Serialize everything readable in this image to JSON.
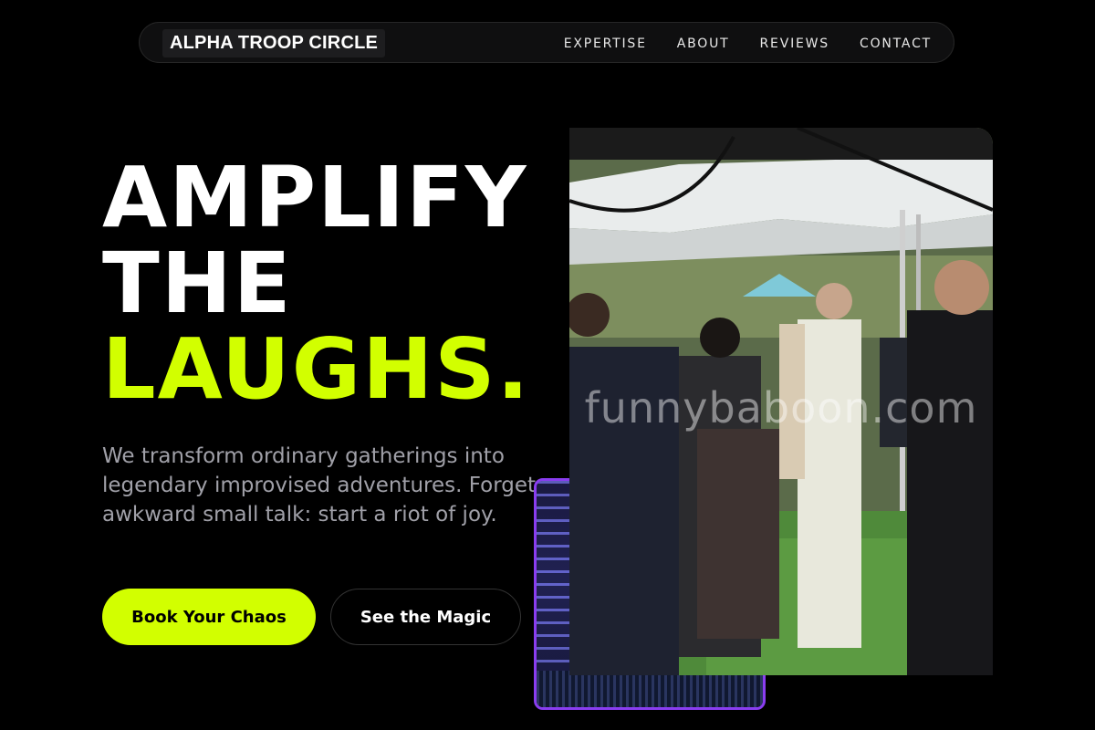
{
  "brand": {
    "name": "ALPHA TROOP CIRCLE"
  },
  "nav": {
    "links": [
      "EXPERTISE",
      "ABOUT",
      "REVIEWS",
      "CONTACT"
    ]
  },
  "hero": {
    "headline_line1": "AMPLIFY",
    "headline_line2": "THE",
    "headline_accent": "LAUGHS.",
    "subtext": "We transform ordinary gatherings into legendary improvised adventures. Forget awkward small talk: start a riot of joy.",
    "primary_button": "Book Your Chaos",
    "secondary_button": "See the Magic"
  },
  "media": {
    "main_image_watermark": "funnybaboon.com",
    "main_image": "crowd-under-tent-photo",
    "secondary_image": "stage-lights-photo"
  },
  "colors": {
    "background": "#000000",
    "accent": "#d2ff00",
    "secondary_frame": "#8a3df0",
    "subtext": "#a0a0a8"
  }
}
